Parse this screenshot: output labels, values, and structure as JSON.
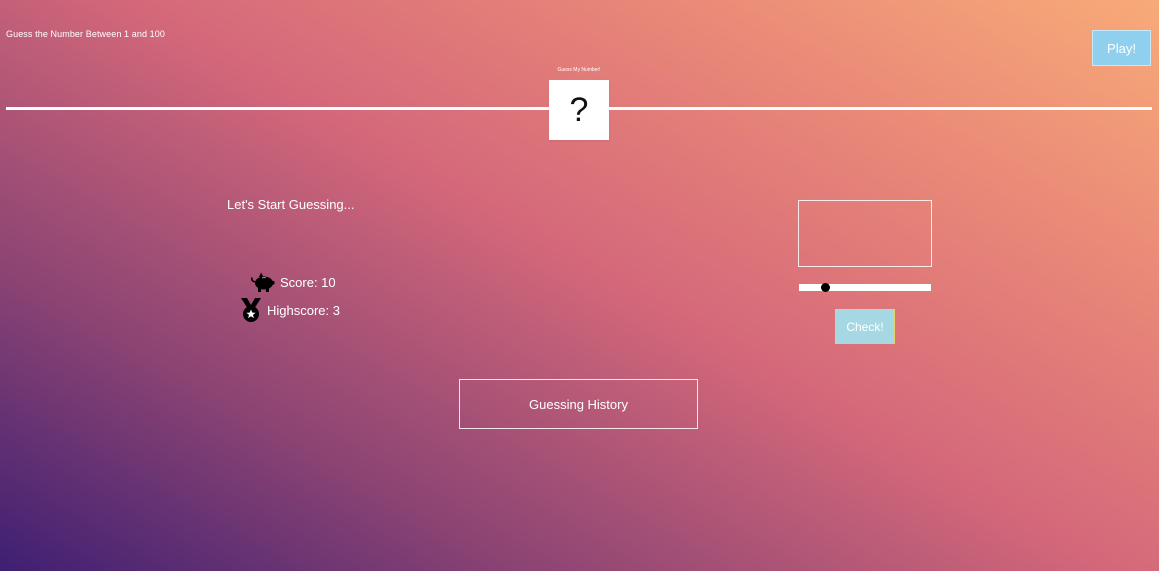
{
  "header": {
    "title": "Guess the Number Between 1 and 100",
    "play_label": "Play!"
  },
  "secret": {
    "label": "Guess My Number!",
    "value": "?"
  },
  "status": {
    "message": "Let's Start Guessing..."
  },
  "stats": {
    "score_label": "Score: 10",
    "score_icon": "piggy-bank-icon",
    "highscore_label": "Highscore: 3",
    "highscore_icon": "medal-icon"
  },
  "guess": {
    "value": "",
    "slider_level": 0.2,
    "check_label": "Check!"
  },
  "history": {
    "button_label": "Guessing History"
  },
  "colors": {
    "play_button": "#8fd0ee",
    "check_button": "#a6d8e4",
    "check_border": "#e3d46a",
    "gradient_dark": "#3e1f73",
    "gradient_mid": "#d4687a",
    "gradient_light": "#f8aa78"
  }
}
